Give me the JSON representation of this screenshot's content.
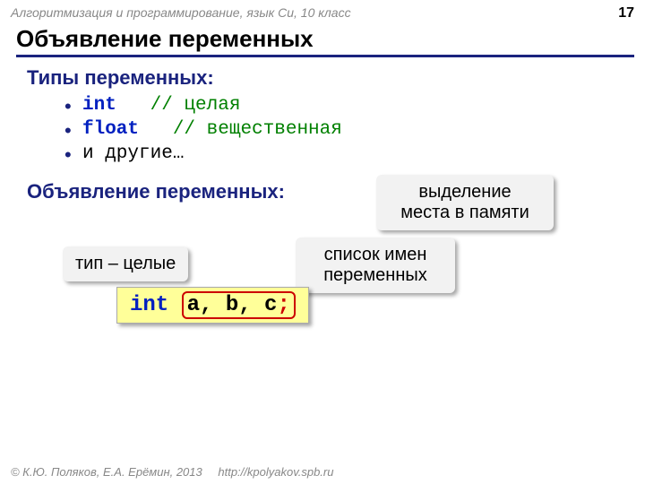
{
  "header": {
    "course": "Алгоритмизация и программирование, язык Си, 10 класс",
    "page": "17"
  },
  "title": "Объявление  переменных",
  "section1": "Типы переменных:",
  "bullets": {
    "b1_kw": "int",
    "b1_cm": "// целая",
    "b2_kw": "float",
    "b2_cm": "// вещественная",
    "b3": "и другие…"
  },
  "section2": "Объявление переменных:",
  "callouts": {
    "c1": "выделение\nместа в памяти",
    "c2": "тип – целые",
    "c3": "список имен\nпеременных"
  },
  "code": {
    "kw": "int",
    "vars": "a, b, c",
    "semi": ";"
  },
  "footer": {
    "copy": "© К.Ю. Поляков, Е.А. Ерёмин, 2013",
    "url": "http://kpolyakov.spb.ru"
  }
}
